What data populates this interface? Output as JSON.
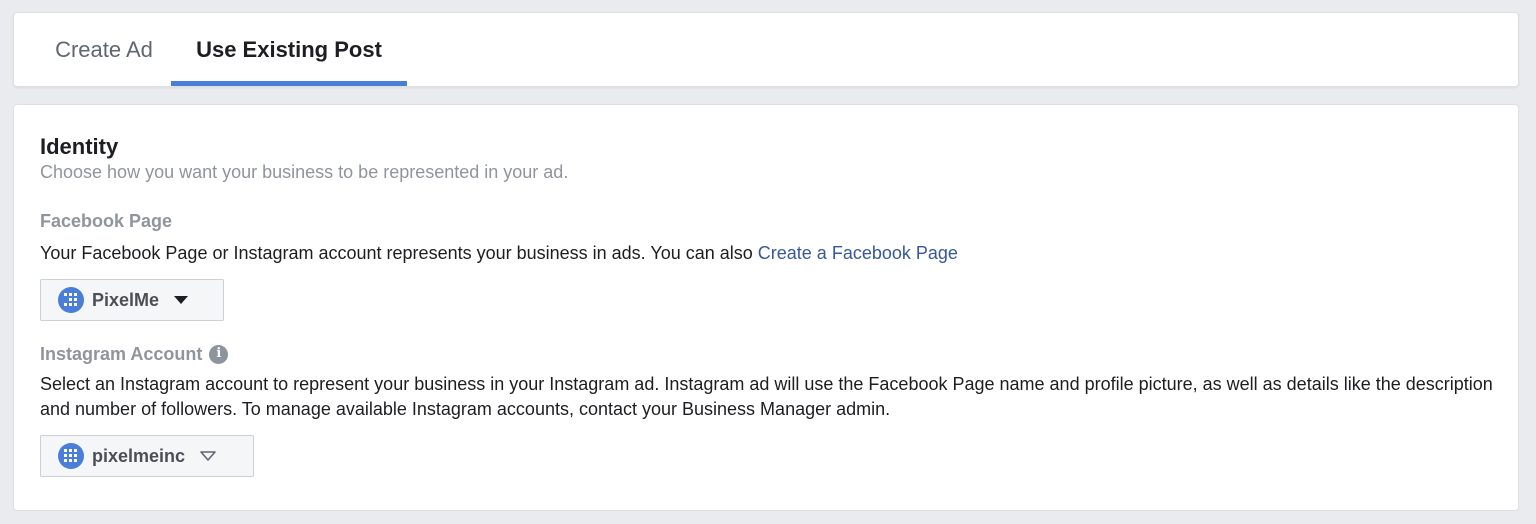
{
  "tabs": {
    "create_ad": "Create Ad",
    "use_existing_post": "Use Existing Post"
  },
  "identity": {
    "title": "Identity",
    "subtitle": "Choose how you want your business to be represented in your ad.",
    "facebook_page": {
      "label": "Facebook Page",
      "description": "Your Facebook Page or Instagram account represents your business in ads. You can also ",
      "link_text": "Create a Facebook Page",
      "selected": "PixelMe",
      "avatar_icon": "pixelme-logo-icon",
      "caret_icon": "caret-down-filled-icon"
    },
    "instagram_account": {
      "label": "Instagram Account",
      "info_icon": "info-icon",
      "description": "Select an Instagram account to represent your business in your Instagram ad. Instagram ad will use the Facebook Page name and profile picture, as well as details like the description and number of followers. To manage available Instagram accounts, contact your Business Manager admin.",
      "selected": "pixelmeinc",
      "avatar_icon": "pixelme-logo-icon",
      "caret_icon": "caret-down-outline-icon"
    }
  },
  "colors": {
    "accent": "#4a7ed9",
    "link": "#365899",
    "muted": "#90949c",
    "text": "#1c1e21",
    "background": "#e9ebee"
  }
}
